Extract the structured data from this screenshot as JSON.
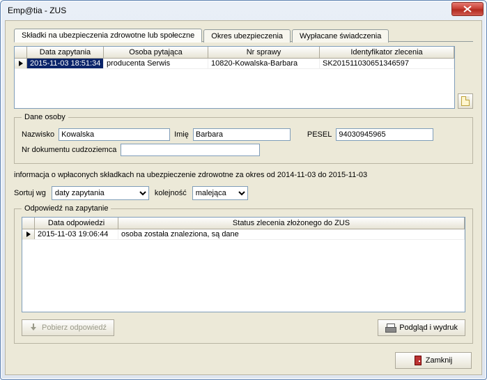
{
  "window": {
    "title": "Emp@tia - ZUS"
  },
  "tabs": {
    "t1": "Składki na ubezpieczenia zdrowotne lub społeczne",
    "t2": "Okres ubezpieczenia",
    "t3": "Wypłacane świadczenia"
  },
  "grid1": {
    "headers": {
      "c1": "Data zapytania",
      "c2": "Osoba pytająca",
      "c3": "Nr sprawy",
      "c4": "Identyfikator zlecenia"
    },
    "row": {
      "c1": "2015-11-03 18:51:34",
      "c2": "producenta Serwis",
      "c3": "10820-Kowalska-Barbara",
      "c4": "SK201511030651346597"
    }
  },
  "person": {
    "legend": "Dane osoby",
    "nazwisko_label": "Nazwisko",
    "nazwisko": "Kowalska",
    "imie_label": "Imię",
    "imie": "Barbara",
    "pesel_label": "PESEL",
    "pesel": "94030945965",
    "nrdoc_label": "Nr dokumentu cudzoziemca",
    "nrdoc": ""
  },
  "info": "informacja o wpłaconych składkach na ubezpieczenie zdrowotne za okres od 2014-11-03 do 2015-11-03",
  "sort": {
    "sortuj_label": "Sortuj wg",
    "sortuj_value": "daty zapytania",
    "kolej_label": "kolejność",
    "kolej_value": "malejąca"
  },
  "response": {
    "legend": "Odpowiedź na zapytanie",
    "headers": {
      "c1": "Data odpowiedzi",
      "c2": "Status zlecenia złożonego do ZUS"
    },
    "row": {
      "c1": "2015-11-03 19:06:44",
      "c2": "osoba została znaleziona, są dane"
    },
    "btn_download": "Pobierz odpowiedź",
    "btn_print": "Podgląd i wydruk"
  },
  "footer": {
    "close": "Zamknij"
  }
}
